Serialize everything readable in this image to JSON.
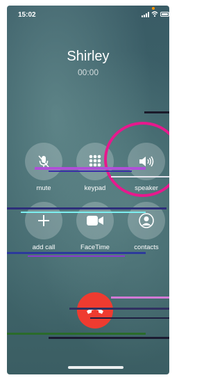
{
  "status_bar": {
    "time": "15:02",
    "indicator_color": "#ff9500"
  },
  "call": {
    "caller_name": "Shirley",
    "duration": "00:00"
  },
  "controls": [
    {
      "label": "mute",
      "icon": "microphone-off-icon"
    },
    {
      "label": "keypad",
      "icon": "keypad-icon"
    },
    {
      "label": "speaker",
      "icon": "speaker-icon"
    },
    {
      "label": "add call",
      "icon": "plus-icon"
    },
    {
      "label": "FaceTime",
      "icon": "video-camera-icon"
    },
    {
      "label": "contacts",
      "icon": "contacts-icon"
    }
  ],
  "end_call": {
    "icon": "phone-hangup-icon",
    "color": "#ef3b30"
  },
  "annotation": {
    "color": "#e6198d"
  }
}
